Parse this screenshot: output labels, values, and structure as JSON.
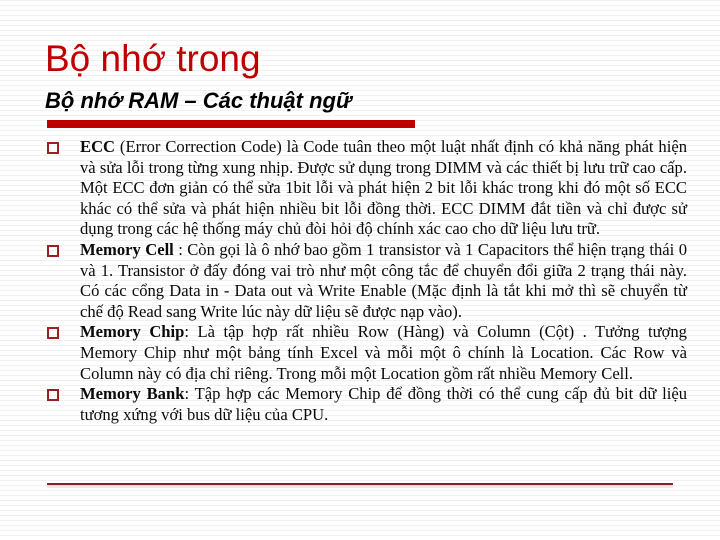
{
  "slide": {
    "title": "Bộ nhớ trong",
    "subtitle": "Bộ nhớ RAM – Các thuật ngữ",
    "accent_color": "#c00000",
    "bullet_color": "#9e2020",
    "bullets": [
      {
        "term": "ECC",
        "term_bold": true,
        "body": " (Error Correction Code) là Code tuân theo một luật nhất định có khả năng phát hiện và sửa lỗi trong từng xung nhịp. Được sử dụng trong DIMM và các thiết bị lưu trữ cao cấp. Một ECC đơn giản có thể sửa 1bit lỗi và phát hiện 2 bit lỗi khác trong khi đó một số ECC khác có thể sửa và phát hiện nhiều bit lỗi đồng thời. ECC DIMM đắt tiền và chỉ được sử dụng trong các hệ thống máy chủ đòi hỏi độ chính xác cao cho dữ liệu lưu trữ."
      },
      {
        "term": "Memory Cell",
        "term_bold": true,
        "body": " : Còn gọi là ô nhớ bao gồm 1 transistor và 1 Capacitors thể hiện trạng thái 0 và 1. Transistor ở đấy đóng vai trò như một công tắc để chuyển đổi giữa 2 trạng thái này. Có các cổng Data in - Data out và Write Enable (Mặc định là tắt khi mở thì sẽ chuyển từ chế độ Read sang Write lúc này dữ liệu sẽ được nạp vào)."
      },
      {
        "term": "Memory Chip",
        "term_bold": true,
        "body": ": Là tập hợp rất nhiều Row (Hàng) và Column (Cột) . Tưởng tượng Memory Chip như một bảng tính Excel và mỗi một ô chính là Location. Các Row và Column này có địa chỉ riêng. Trong mỗi một Location gồm rất nhiều Memory Cell."
      },
      {
        "term": "Memory Bank",
        "term_bold": true,
        "body": ": Tập hợp các Memory Chip để đồng thời có thể cung cấp đủ bit dữ liệu tương xứng với bus dữ liệu của CPU."
      }
    ]
  }
}
